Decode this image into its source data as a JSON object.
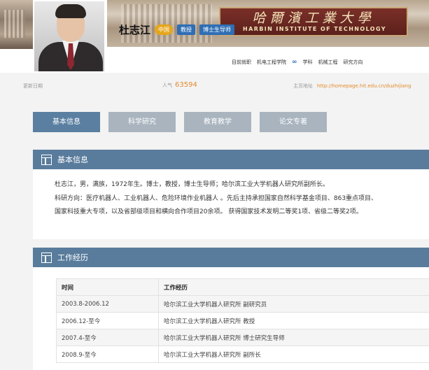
{
  "header": {
    "banner_cn": "哈爾濱工業大學",
    "banner_en": "HARBIN INSTITUTE OF TECHNOLOGY",
    "name": "杜志江",
    "badges": [
      "中国",
      "教授",
      "博士生导师"
    ],
    "tags": {
      "current_job": "目前就职",
      "college": "机电工程学院",
      "subject_label": "学科",
      "subject": "机械工程",
      "research_label": "研究方向"
    }
  },
  "meta": {
    "update_label": "更新日期",
    "popularity_label": "人气",
    "popularity": "63594",
    "homepage_label": "主页地址",
    "homepage_url": "http://homepage.hit.edu.cn/duzhijiang"
  },
  "tabs": [
    "基本信息",
    "科学研究",
    "教育教学",
    "论文专著"
  ],
  "sections": {
    "basic": {
      "title": "基本信息",
      "lines": [
        "杜志江，男，满族，1972年生。博士，教授，博士生导师；哈尔滨工业大学机器人研究所副所长。",
        "科研方向：医疗机器人、工业机器人、危险环境作业机器人 。先后主持承担国家自然科学基金项目、863重点项目、",
        "国家科技重大专项，以及省部级项目和横向合作项目20余项。 获得国家技术发明二等奖1项、省级二等奖2项。"
      ]
    },
    "work": {
      "title": "工作经历",
      "headers": [
        "时间",
        "工作经历"
      ],
      "rows": [
        [
          "2003.8-2006.12",
          "哈尔滨工业大学机器人研究所 副研究员"
        ],
        [
          "2006.12-至今",
          "哈尔滨工业大学机器人研究所 教授"
        ],
        [
          "2007.4-至今",
          "哈尔滨工业大学机器人研究所 博士研究生导师"
        ],
        [
          "2008.9-至今",
          "哈尔滨工业大学机器人研究所 副所长"
        ]
      ]
    }
  },
  "colors": {
    "tab_active": "#5a7fa1",
    "tab_inactive": "#a9b4bf",
    "section_header": "#597c9c",
    "accent_orange": "#e58a2b"
  }
}
